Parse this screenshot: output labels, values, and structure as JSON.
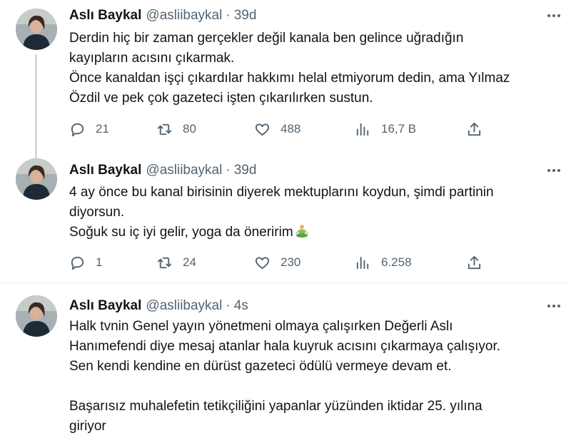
{
  "tweets": [
    {
      "author": {
        "name": "Aslı Baykal",
        "handle": "@asliibaykal",
        "separator": "·",
        "time": "39d"
      },
      "lines": [
        "Derdin hiç bir zaman  gerçekler değil kanala ben gelince uğradığın",
        "kayıpların acısını çıkarmak.",
        "Önce kanaldan işçi çıkardılar hakkımı helal etmiyorum  dedin, ama Yılmaz",
        "Özdil ve pek çok gazeteci işten çıkarılırken sustun."
      ],
      "stats": {
        "replies": "21",
        "retweets": "80",
        "likes": "488",
        "views": "16,7 B"
      }
    },
    {
      "author": {
        "name": "Aslı Baykal",
        "handle": "@asliibaykal",
        "separator": "·",
        "time": "39d"
      },
      "lines": [
        "4 ay önce bu kanal birisinin diyerek mektuplarını koydun, şimdi partinin",
        "diyorsun.",
        "Soğuk su iç iyi gelir, yoga da öneririm"
      ],
      "emoji": "person-in-lotus-position-icon",
      "stats": {
        "replies": "1",
        "retweets": "24",
        "likes": "230",
        "views": "6.258"
      }
    },
    {
      "author": {
        "name": "Aslı Baykal",
        "handle": "@asliibaykal",
        "separator": "·",
        "time": "4s"
      },
      "lines": [
        "Halk tvnin Genel yayın yönetmeni olmaya çalışırken Değerli Aslı",
        "Hanımefendi diye mesaj atanlar hala kuyruk acısını çıkarmaya çalışıyor.",
        "Sen kendi kendine en dürüst gazeteci ödülü vermeye devam et.",
        "",
        "Başarısız muhalefetin tetikçiliğini yapanlar  yüzünden iktidar 25. yılına",
        "giriyor"
      ]
    }
  ],
  "icons": {
    "reply": "reply-icon",
    "retweet": "retweet-icon",
    "like": "like-icon",
    "views": "views-icon",
    "share": "share-icon",
    "more": "more-icon"
  },
  "colors": {
    "text": "#0f1419",
    "secondary": "#536471",
    "thread_line": "#cfd9de",
    "divider": "#eff3f4",
    "background": "#ffffff"
  }
}
